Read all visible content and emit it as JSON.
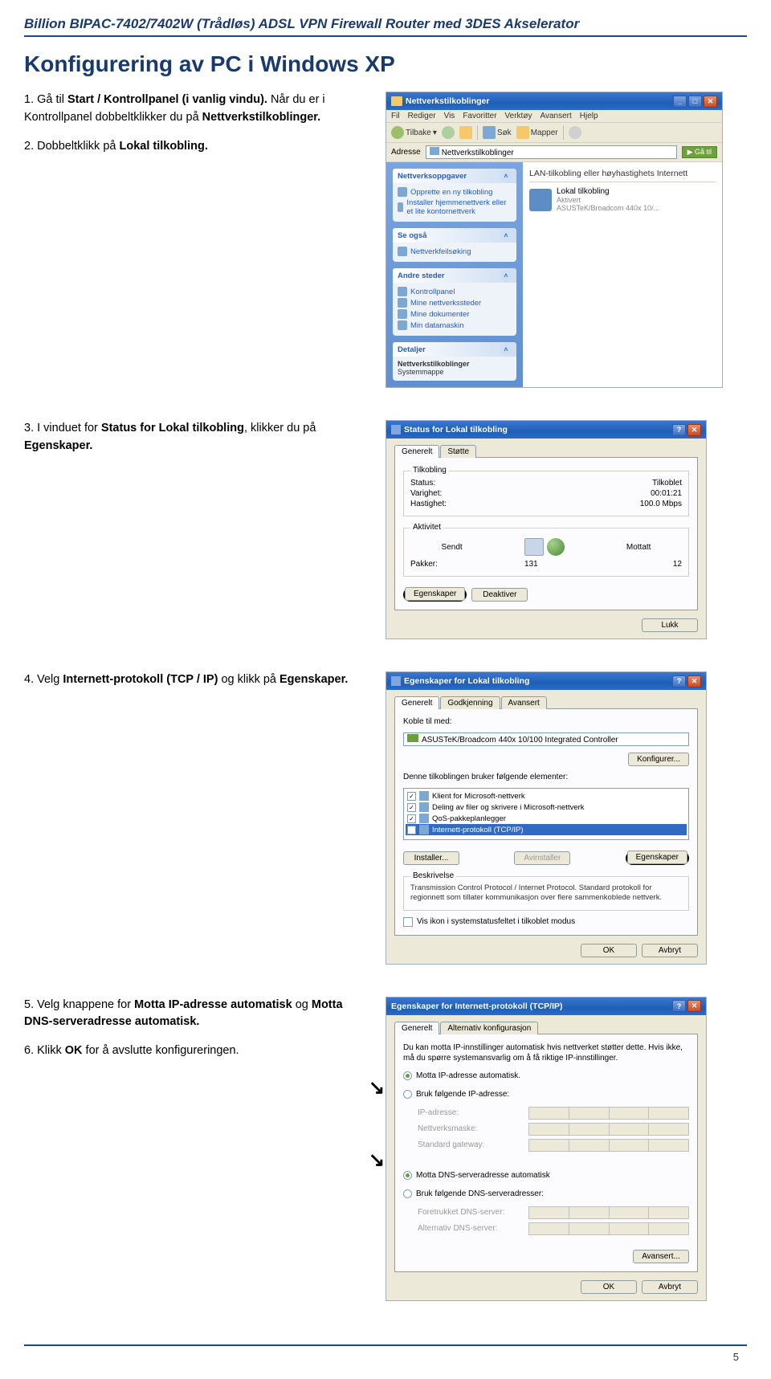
{
  "header": "Billion BIPAC-7402/7402W (Trådløs) ADSL VPN Firewall Router med 3DES Akselerator",
  "title": "Konfigurering av PC i Windows XP",
  "steps": {
    "s1a": "1. Gå til ",
    "s1b": "Start / Kontrollpanel (i vanlig vindu).",
    "s1c": " Når du er i Kontrollpanel  dobbeltklikker du på ",
    "s1d": "Nettverkstilkoblinger.",
    "s2a": "2. Dobbeltklikk på ",
    "s2b": "Lokal tilkobling.",
    "s3a": "3. I vinduet for ",
    "s3b": "Status for Lokal tilkobling",
    "s3c": ", klikker du på ",
    "s3d": "Egenskaper.",
    "s4a": "4. Velg ",
    "s4b": "Internett-protokoll (TCP / IP)",
    "s4c": " og klikk på ",
    "s4d": "Egenskaper.",
    "s5a": "5. Velg knappene for ",
    "s5b": "Motta IP-adresse automatisk",
    "s5c": " og ",
    "s5d": "Motta DNS-serveradresse automatisk.",
    "s6a": "6. Klikk ",
    "s6b": "OK",
    "s6c": " for å avslutte konfigureringen."
  },
  "ss1": {
    "title": "Nettverkstilkoblinger",
    "menu": [
      "Fil",
      "Rediger",
      "Vis",
      "Favoritter",
      "Verktøy",
      "Avansert",
      "Hjelp"
    ],
    "tb_back": "Tilbake",
    "tb_search": "Søk",
    "tb_folders": "Mapper",
    "addr_label": "Adresse",
    "addr_value": "Nettverkstilkoblinger",
    "addr_go": "Gå til",
    "panel1_head": "Nettverksoppgaver",
    "panel1_items": [
      "Opprette en ny tilkobling",
      "Installer hjemmenettverk eller et lite kontornettverk"
    ],
    "panel2_head": "Se også",
    "panel2_items": [
      "Nettverkfeilsøking"
    ],
    "panel3_head": "Andre steder",
    "panel3_items": [
      "Kontrollpanel",
      "Mine nettverkssteder",
      "Mine dokumenter",
      "Min datamaskin"
    ],
    "panel4_head": "Detaljer",
    "panel4_text1": "Nettverkstilkoblinger",
    "panel4_text2": "Systemmappe",
    "main_head": "LAN-tilkobling eller høyhastighets Internett",
    "main_item_primary": "Lokal tilkobling",
    "main_item_sub1": "Aktivert",
    "main_item_sub2": "ASUSTeK/Broadcom 440x 10/..."
  },
  "ss2": {
    "title": "Status for Lokal tilkobling",
    "tab1": "Generelt",
    "tab2": "Støtte",
    "grp1": "Tilkobling",
    "r1a": "Status:",
    "r1b": "Tilkoblet",
    "r2a": "Varighet:",
    "r2b": "00:01:21",
    "r3a": "Hastighet:",
    "r3b": "100.0 Mbps",
    "grp2": "Aktivitet",
    "sent": "Sendt",
    "recv": "Mottatt",
    "pkts": "Pakker:",
    "pkts_sent": "131",
    "pkts_recv": "12",
    "btn_props": "Egenskaper",
    "btn_deact": "Deaktiver",
    "btn_close": "Lukk"
  },
  "ss3": {
    "title": "Egenskaper for Lokal tilkobling",
    "tab1": "Generelt",
    "tab2": "Godkjenning",
    "tab3": "Avansert",
    "connect_label": "Koble til med:",
    "adapter": "ASUSTeK/Broadcom 440x 10/100 Integrated Controller",
    "btn_config": "Konfigurer...",
    "elements_label": "Denne tilkoblingen bruker følgende elementer:",
    "items": [
      {
        "chk": "✓",
        "label": "Klient for Microsoft-nettverk"
      },
      {
        "chk": "✓",
        "label": "Deling av filer og skrivere i Microsoft-nettverk"
      },
      {
        "chk": "✓",
        "label": "QoS-pakkeplanlegger"
      },
      {
        "chk": "✓",
        "label": "Internett-protokoll (TCP/IP)"
      }
    ],
    "btn_install": "Installer...",
    "btn_uninstall": "Avinstaller",
    "btn_props": "Egenskaper",
    "desc_head": "Beskrivelse",
    "desc": "Transmission Control Protocol / Internet Protocol. Standard protokoll for regionnett som tillater kommunikasjon over flere sammenkoblede nettverk.",
    "chk_tray": "Vis ikon i systemstatusfeltet i tilkoblet modus",
    "btn_ok": "OK",
    "btn_cancel": "Avbryt"
  },
  "ss4": {
    "title": "Egenskaper for Internett-protokoll (TCP/IP)",
    "tab1": "Generelt",
    "tab2": "Alternativ konfigurasjon",
    "intro": "Du kan motta IP-innstillinger automatisk hvis nettverket støtter dette. Hvis ikke, må du spørre systemansvarlig om å få riktige IP-innstillinger.",
    "r1": "Motta IP-adresse automatisk.",
    "r2": "Bruk følgende IP-adresse:",
    "lbl_ip": "IP-adresse:",
    "lbl_mask": "Nettverksmaske:",
    "lbl_gw": "Standard gateway:",
    "r3": "Motta DNS-serveradresse automatisk",
    "r4": "Bruk følgende DNS-serveradresser:",
    "lbl_dns1": "Foretrukket DNS-server:",
    "lbl_dns2": "Alternativ DNS-server:",
    "btn_adv": "Avansert...",
    "btn_ok": "OK",
    "btn_cancel": "Avbryt"
  },
  "page_number": "5"
}
